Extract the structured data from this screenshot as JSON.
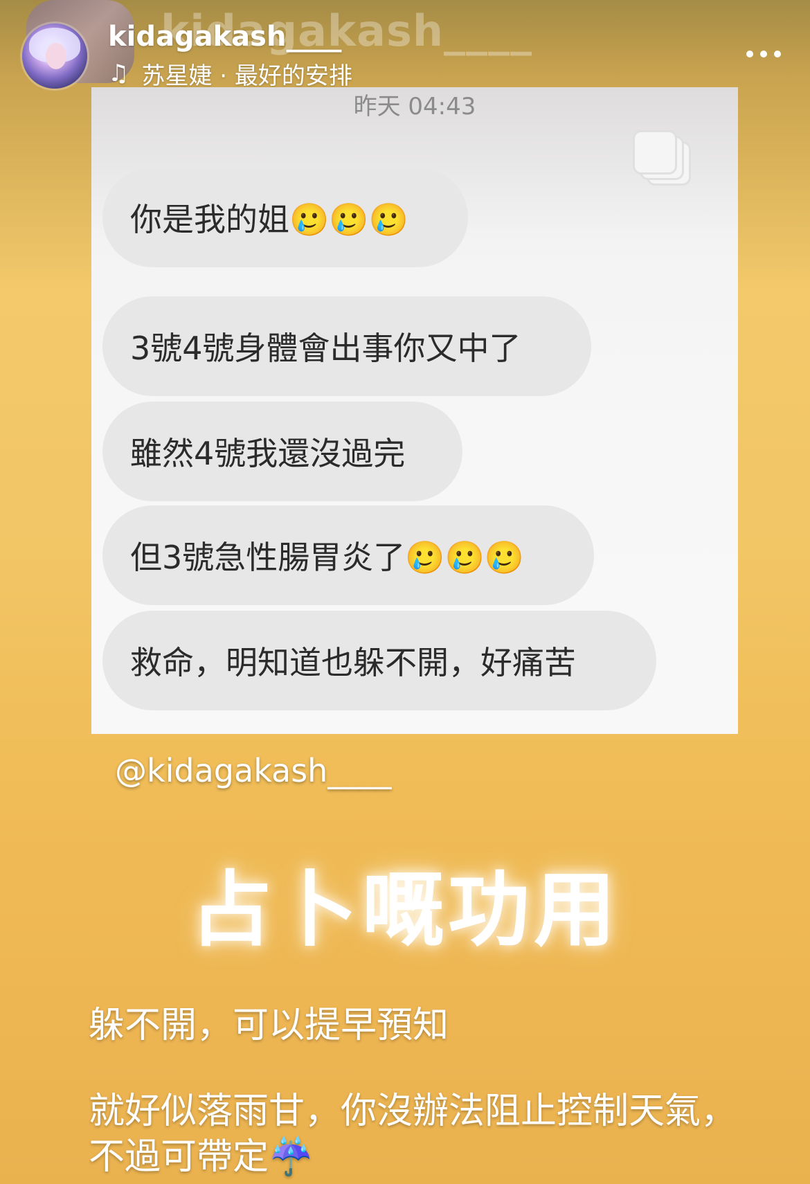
{
  "header": {
    "username": "kidagakash____",
    "music": "苏星婕 · 最好的安排",
    "more_icon": "more-dots-icon",
    "music_icon": "music-note-icon"
  },
  "chat": {
    "timestamp": "昨天 04:43",
    "messages": [
      "你是我的姐🥲🥲🥲",
      "3號4號身體會出事你又中了",
      "雖然4號我還沒過完",
      "但3號急性腸胃炎了🥲🥲🥲",
      "救命，明知道也躲不開，好痛苦"
    ]
  },
  "story": {
    "mention": "@kidagakash____",
    "heading": "占卜嘅功用",
    "line1": "躲不開，可以提早預知",
    "line2": "就好似落雨甘，你沒辦法阻止控制天氣，",
    "line3": "不過可帶定☔️"
  }
}
